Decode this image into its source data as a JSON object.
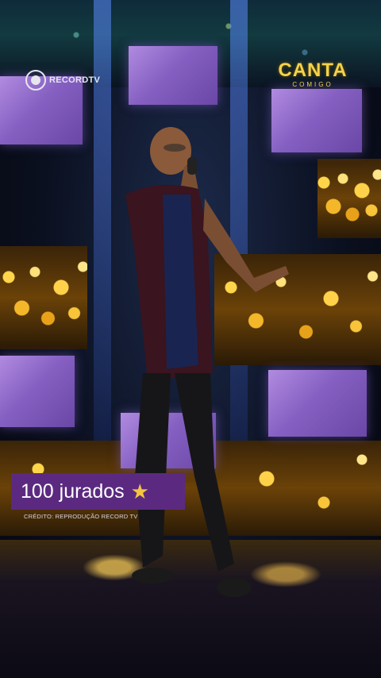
{
  "watermark": {
    "channel_logo": "RECORDTV",
    "channel_icon": "record-logo-icon"
  },
  "show_logo": {
    "title": "CANTA",
    "subtitle": "COMIGO"
  },
  "caption": {
    "text": "100 jurados",
    "icon": "star-icon"
  },
  "credit": {
    "text": "CRÉDITO: REPRODUÇÃO RECORD TV"
  },
  "colors": {
    "caption_bg": "#5b2a80",
    "logo_gold": "#f4d24a",
    "panel_purple": "#8560c2",
    "star": "#f5c542"
  }
}
